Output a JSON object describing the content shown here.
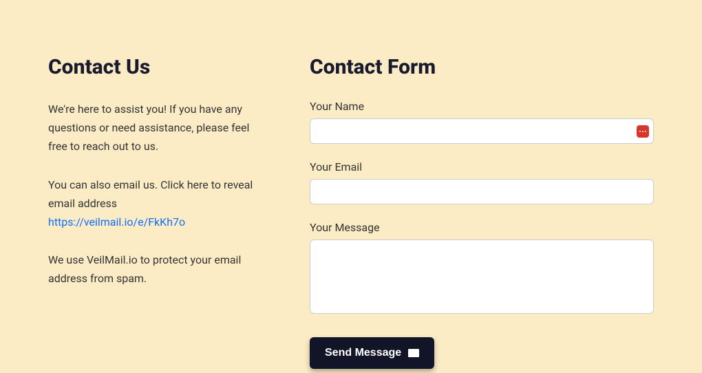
{
  "left": {
    "heading": "Contact Us",
    "intro": "We're here to assist you! If you have any questions or need assistance, please feel free to reach out to us.",
    "email_intro": "You can also email us. Click here to reveal email address ",
    "email_link": "https://veilmail.io/e/FkKh7o",
    "veilmail": "We use VeilMail.io to protect your email address from spam."
  },
  "form": {
    "heading": "Contact Form",
    "name_label": "Your Name",
    "name_value": "",
    "email_label": "Your Email",
    "email_value": "",
    "message_label": "Your Message",
    "message_value": "",
    "submit_label": "Send Message"
  }
}
